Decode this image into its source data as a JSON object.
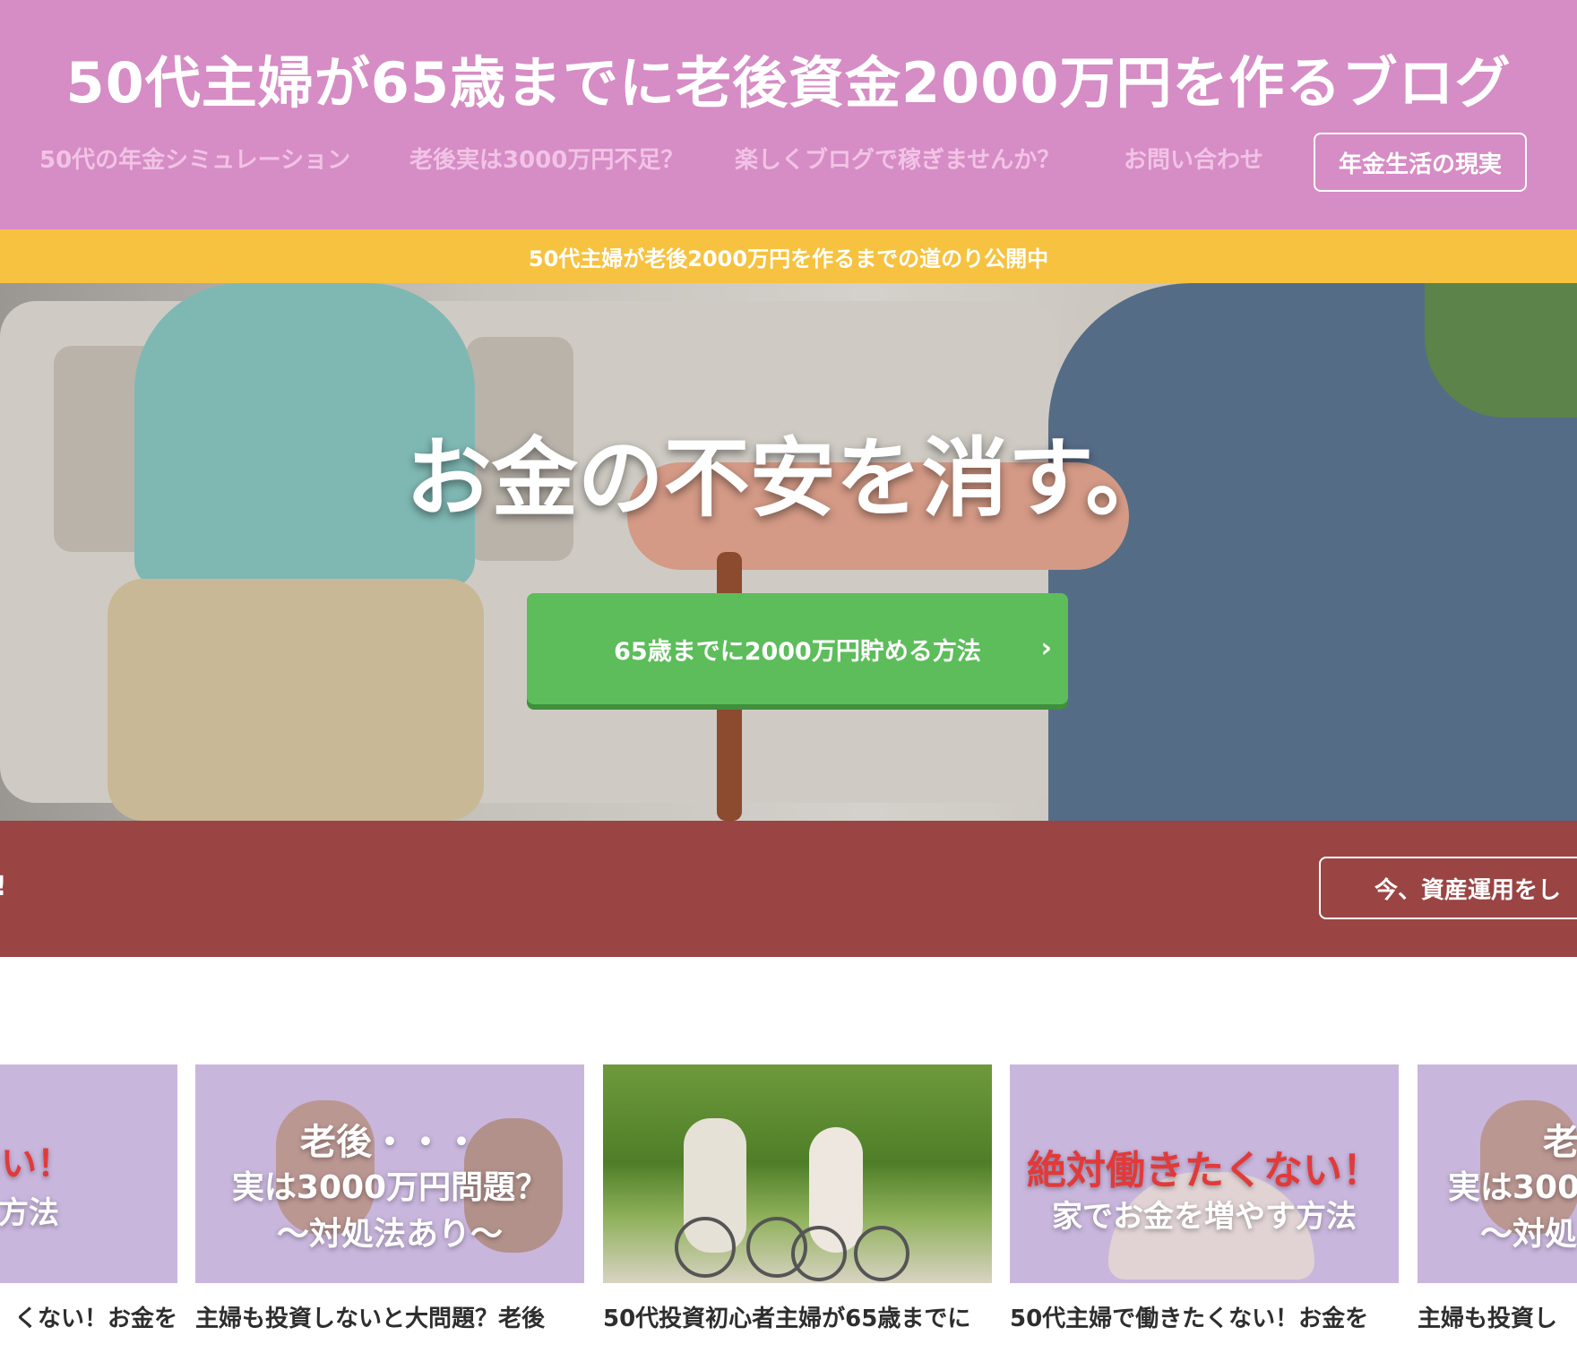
{
  "header": {
    "site_title": "50代主婦が65歳までに老後資金2000万円を作るブログ",
    "nav": [
      {
        "label": "50代の年金シミュレーション"
      },
      {
        "label": "老後実は3000万円不足？"
      },
      {
        "label": "楽しくブログで稼ぎませんか？"
      },
      {
        "label": "お問い合わせ"
      }
    ],
    "nav_cta": "年金生活の現実"
  },
  "notice": "50代主婦が老後2000万円を作るまでの道のり公開中",
  "hero": {
    "headline": "お金の不安を消す。",
    "button_label": "65歳までに2000万円貯める方法",
    "button_icon": "chevron-right-icon"
  },
  "band": {
    "left_text": "!",
    "button_label": "今、資産運用をし"
  },
  "cards": [
    {
      "thumb_lines": [
        "たくない！",
        "増やす方法"
      ],
      "thumb_colors": [
        "#e23a3a",
        "#ffffff"
      ],
      "title": "くない！お金を"
    },
    {
      "thumb_lines": [
        "老後・・・",
        "実は3000万円問題？",
        "〜対処法あり〜"
      ],
      "thumb_colors": [
        "#ffffff",
        "#ffffff",
        "#ffffff"
      ],
      "title": "主婦も投資しないと大問題？老後"
    },
    {
      "thumb_lines": [],
      "thumb_colors": [],
      "title": "50代投資初心者主婦が65歳までに"
    },
    {
      "thumb_lines": [
        "絶対働きたくない！",
        "家でお金を増やす方法"
      ],
      "thumb_colors": [
        "#e23a3a",
        "#ffffff"
      ],
      "title": "50代主婦で働きたくない！お金を"
    },
    {
      "thumb_lines": [
        "老後",
        "実は300",
        "〜対処"
      ],
      "thumb_colors": [
        "#ffffff",
        "#ffffff",
        "#ffffff"
      ],
      "title": "主婦も投資し"
    }
  ],
  "colors": {
    "header_bg": "#d68cc4",
    "notice_bg": "#f6c240",
    "hero_button": "#5cbd5a",
    "band_bg": "#9a4444"
  }
}
